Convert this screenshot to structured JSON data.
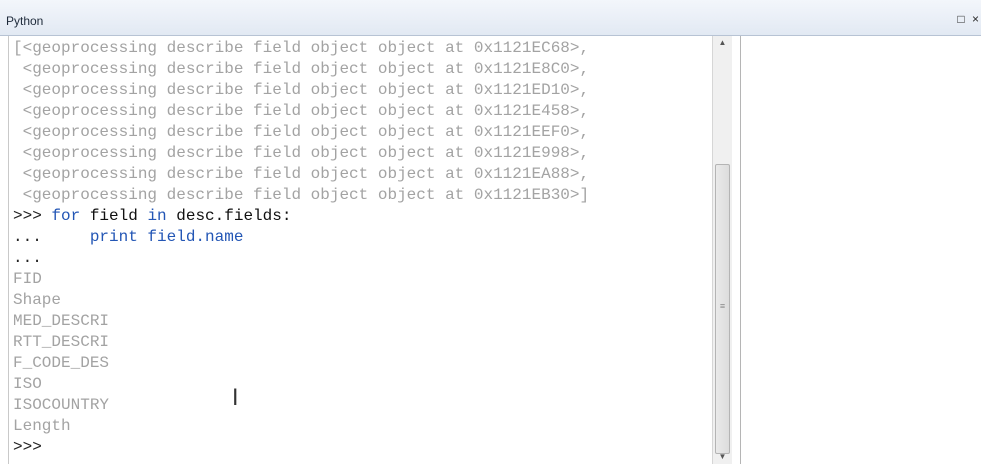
{
  "window": {
    "title": "Python",
    "controls": [
      "□",
      "×"
    ]
  },
  "console": {
    "lines": [
      {
        "type": "out",
        "text": "[<geoprocessing describe field object object at 0x1121EC68>,"
      },
      {
        "type": "out",
        "text": " <geoprocessing describe field object object at 0x1121E8C0>,"
      },
      {
        "type": "out",
        "text": " <geoprocessing describe field object object at 0x1121ED10>,"
      },
      {
        "type": "out",
        "text": " <geoprocessing describe field object object at 0x1121E458>,"
      },
      {
        "type": "out",
        "text": " <geoprocessing describe field object object at 0x1121EEF0>,"
      },
      {
        "type": "out",
        "text": " <geoprocessing describe field object object at 0x1121E998>,"
      },
      {
        "type": "out",
        "text": " <geoprocessing describe field object object at 0x1121EA88>,"
      },
      {
        "type": "out",
        "text": " <geoprocessing describe field object object at 0x1121EB30>]"
      },
      {
        "type": "input",
        "prompt": ">>> ",
        "keyword": "for",
        "code1": " field ",
        "keyword2": "in",
        "code2": " desc.fields:"
      },
      {
        "type": "input2",
        "prompt": "...     ",
        "code": "print field.name"
      },
      {
        "type": "prompt",
        "text": "..."
      },
      {
        "type": "out",
        "text": "FID"
      },
      {
        "type": "out",
        "text": "Shape"
      },
      {
        "type": "out",
        "text": "MED_DESCRI"
      },
      {
        "type": "out",
        "text": "RTT_DESCRI"
      },
      {
        "type": "out",
        "text": "F_CODE_DES"
      },
      {
        "type": "out",
        "text": "ISO"
      },
      {
        "type": "out",
        "text": "ISOCOUNTRY"
      },
      {
        "type": "out",
        "text": "Length"
      },
      {
        "type": "prompt",
        "text": ">>>"
      }
    ]
  },
  "scrollbar": {
    "up_arrow": "▲",
    "down_arrow": "▼",
    "grip": "≡"
  }
}
